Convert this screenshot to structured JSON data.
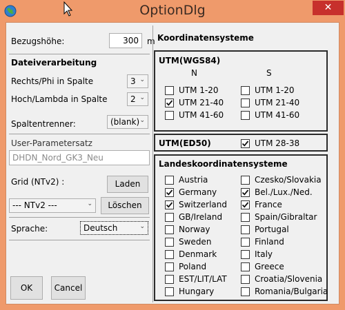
{
  "window": {
    "title": "OptionDlg",
    "close_label": "✕"
  },
  "left": {
    "bezugshoehe_label": "Bezugshöhe:",
    "bezugshoehe_value": "300",
    "bezugshoehe_unit": "m",
    "dateiverarbeitung_label": "Dateiverarbeitung",
    "rechts_label": "Rechts/Phi in Spalte",
    "rechts_value": "3",
    "hoch_label": "Hoch/Lambda in Spalte",
    "hoch_value": "2",
    "spaltentrenner_label": "Spaltentrenner:",
    "spaltentrenner_value": "(blank)",
    "user_param_label": "User-Parametersatz",
    "user_param_value": "DHDN_Nord_GK3_Neu",
    "grid_label": "Grid (NTv2) :",
    "laden_label": "Laden",
    "ntv2_value": "--- NTv2 ---",
    "loeschen_label": "Löschen",
    "sprache_label": "Sprache:",
    "sprache_value": "Deutsch",
    "ok_label": "OK",
    "cancel_label": "Cancel"
  },
  "right": {
    "koordinaten_label": "Koordinatensysteme",
    "utm_wgs84": {
      "title": "UTM(WGS84)",
      "col_n": "N",
      "col_s": "S",
      "n_items": [
        {
          "label": "UTM 1-20",
          "checked": false
        },
        {
          "label": "UTM 21-40",
          "checked": true
        },
        {
          "label": "UTM 41-60",
          "checked": false
        }
      ],
      "s_items": [
        {
          "label": "UTM 1-20",
          "checked": false
        },
        {
          "label": "UTM 21-40",
          "checked": false
        },
        {
          "label": "UTM 41-60",
          "checked": false
        }
      ]
    },
    "utm_ed50": {
      "title": "UTM(ED50)",
      "item": {
        "label": "UTM 28-38",
        "checked": true
      }
    },
    "landes": {
      "title": "Landeskoordinatensysteme",
      "left_items": [
        {
          "label": "Austria",
          "checked": false
        },
        {
          "label": "Germany",
          "checked": true
        },
        {
          "label": "Switzerland",
          "checked": true
        },
        {
          "label": "GB/Ireland",
          "checked": false
        },
        {
          "label": "Norway",
          "checked": false
        },
        {
          "label": "Sweden",
          "checked": false
        },
        {
          "label": "Denmark",
          "checked": false
        },
        {
          "label": "Poland",
          "checked": false
        },
        {
          "label": "EST/LIT/LAT",
          "checked": false
        },
        {
          "label": "Hungary",
          "checked": false
        }
      ],
      "right_items": [
        {
          "label": "Czesko/Slovakia",
          "checked": false
        },
        {
          "label": "Bel./Lux./Ned.",
          "checked": true
        },
        {
          "label": "France",
          "checked": true
        },
        {
          "label": "Spain/Gibraltar",
          "checked": false
        },
        {
          "label": "Portugal",
          "checked": false
        },
        {
          "label": "Finland",
          "checked": false
        },
        {
          "label": "Italy",
          "checked": false
        },
        {
          "label": "Greece",
          "checked": false
        },
        {
          "label": "Croatia/Slovenia",
          "checked": false
        },
        {
          "label": "Romania/Bulgaria",
          "checked": false
        }
      ]
    }
  }
}
